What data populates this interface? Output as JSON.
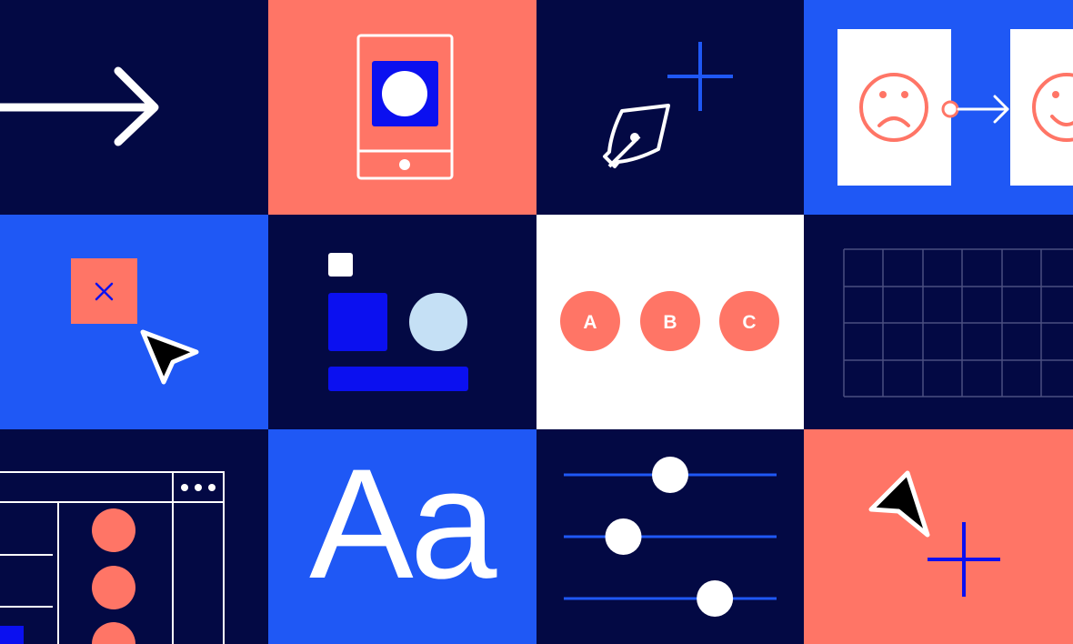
{
  "colors": {
    "navy": "#030944",
    "coral": "#FF7566",
    "blue": "#1F58F5",
    "deep_blue": "#0B10F0",
    "light_blue": "#C5E0F5",
    "white": "#FFFFFF",
    "black": "#000000"
  },
  "tiles": [
    {
      "name": "arrow-right-tile",
      "icon": "arrow-right-icon"
    },
    {
      "name": "mobile-phone-tile",
      "icon": "mobile-phone-icon"
    },
    {
      "name": "pen-tool-tile",
      "icon": "pen-tool-icon"
    },
    {
      "name": "sad-to-happy-tile",
      "icon": "sad-face-icon, happy-face-icon"
    },
    {
      "name": "close-box-cursor-tile",
      "icon": "close-icon, cursor-icon"
    },
    {
      "name": "shapes-layout-tile",
      "icon": "shapes-icon"
    },
    {
      "name": "abc-options-tile",
      "icon": "option-circles"
    },
    {
      "name": "grid-lines-tile",
      "icon": "grid-icon"
    },
    {
      "name": "app-window-tile",
      "icon": "window-icon"
    },
    {
      "name": "typography-tile",
      "icon": "text-sample"
    },
    {
      "name": "sliders-tile",
      "icon": "slider-icon"
    },
    {
      "name": "cursor-plus-tile",
      "icon": "cursor-icon, plus-icon"
    }
  ],
  "abc_options": [
    "A",
    "B",
    "C"
  ],
  "typography_sample": "Aa",
  "sliders": [
    0.5,
    0.28,
    0.71
  ]
}
